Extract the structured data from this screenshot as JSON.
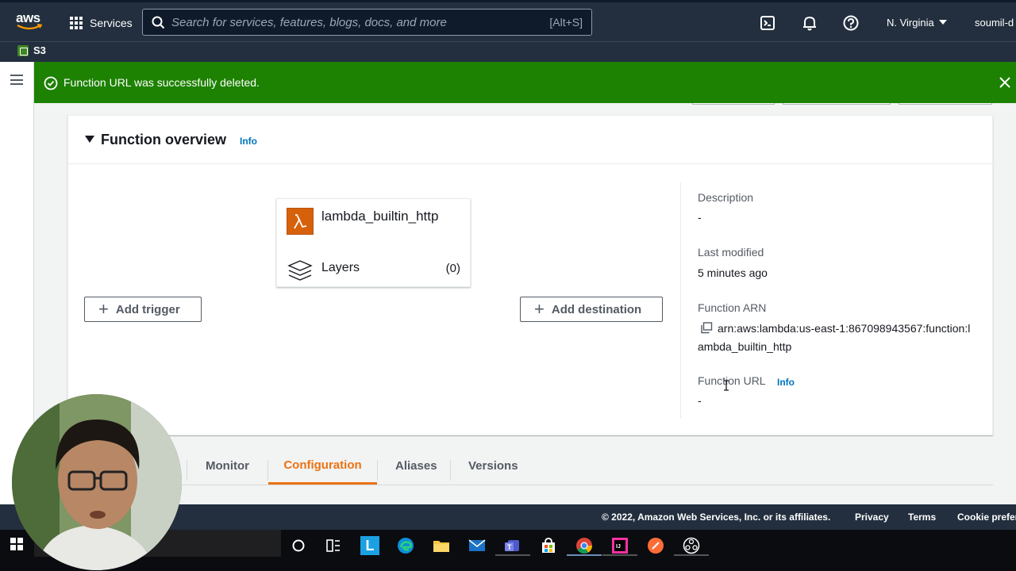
{
  "topnav": {
    "logo": "aws",
    "services_label": "Services",
    "search_placeholder": "Search for services, features, blogs, docs, and more",
    "search_shortcut": "[Alt+S]",
    "region": "N. Virginia",
    "user": "soumil-d"
  },
  "favorites": {
    "s3_label": "S3"
  },
  "flash": {
    "message": "Function URL was successfully deleted.",
    "color": "#1d8102"
  },
  "overview": {
    "title": "Function overview",
    "info": "Info",
    "function_name": "lambda_builtin_http",
    "layers_label": "Layers",
    "layers_count": "(0)",
    "add_trigger": "Add trigger",
    "add_destination": "Add destination",
    "description_label": "Description",
    "description_value": "-",
    "last_modified_label": "Last modified",
    "last_modified_value": "5 minutes ago",
    "arn_label": "Function ARN",
    "arn_value": "arn:aws:lambda:us-east-1:867098943567:function:lambda_builtin_http",
    "url_label": "Function URL",
    "url_info": "Info",
    "url_value": "-"
  },
  "tabs": {
    "items": [
      "Monitor",
      "Configuration",
      "Aliases",
      "Versions"
    ],
    "active": "Configuration",
    "accent": "#ec7211"
  },
  "footer": {
    "copyright": "© 2022, Amazon Web Services, Inc. or its affiliates.",
    "privacy": "Privacy",
    "terms": "Terms",
    "cookie": "Cookie prefer"
  },
  "icons": {
    "taskbar": [
      "windows-start-icon",
      "cortana-icon",
      "task-view-icon",
      "l-app-icon",
      "edge-icon",
      "file-explorer-icon",
      "mail-icon",
      "teams-icon",
      "store-icon",
      "chrome-icon",
      "intellij-icon",
      "postman-icon",
      "obs-icon"
    ]
  }
}
